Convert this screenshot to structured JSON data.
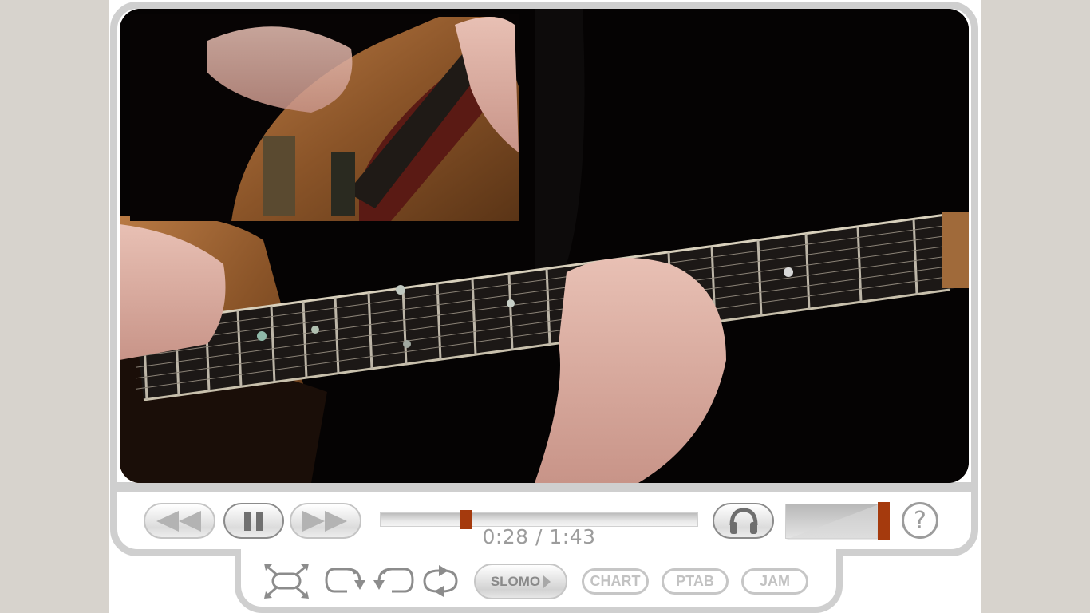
{
  "player": {
    "video": {
      "description": "Guitar lesson video: close-up of hands playing an electric guitar fretboard with inset camera view",
      "state": "playing"
    },
    "transport": {
      "rewind_icon": "rewind-icon",
      "pause_icon": "pause-icon",
      "fast_forward_icon": "fast-forward-icon"
    },
    "progress": {
      "current_time": "0:28",
      "total_time": "1:43",
      "time_display": "0:28 / 1:43",
      "fraction": 0.27
    },
    "audio_icon": "headphones-icon",
    "volume": {
      "level_percent": 100
    },
    "help_label": "?",
    "accent_color": "#a53a0d"
  },
  "toolbar": {
    "fullscreen_icon": "fullscreen-icon",
    "loop_forward_icon": "loop-forward-icon",
    "loop_back_icon": "loop-back-icon",
    "loop_icon": "loop-icon",
    "slomo_label": "SLOMO",
    "chart_label": "CHART",
    "ptab_label": "PTAB",
    "jam_label": "JAM"
  }
}
